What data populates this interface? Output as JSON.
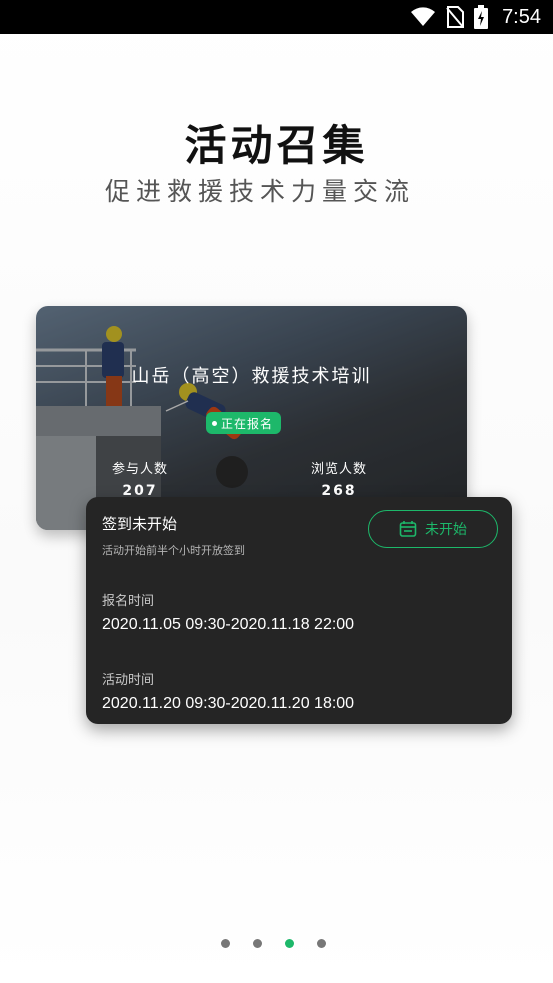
{
  "status_bar": {
    "time": "7:54",
    "icons": [
      "wifi-icon",
      "no-sim-icon",
      "battery-charging-icon"
    ]
  },
  "header": {
    "title": "活动召集",
    "subtitle": "促进救援技术力量交流"
  },
  "event_card": {
    "title": "山岳（高空）救援技术培训",
    "badge": "正在报名",
    "participants_label": "参与人数",
    "participants_value": "207",
    "views_label": "浏览人数",
    "views_value": "268"
  },
  "info_card": {
    "signin_title": "签到未开始",
    "signin_note": "活动开始前半个小时开放签到",
    "status_button": "未开始",
    "registration_label": "报名时间",
    "registration_value": "2020.11.05 09:30-2020.11.18 22:00",
    "activity_label": "活动时间",
    "activity_value": "2020.11.20 09:30-2020.11.20 18:00"
  },
  "pager": {
    "count": 4,
    "active_index": 2
  },
  "colors": {
    "accent": "#1db86a",
    "card_dark": "#252525"
  }
}
